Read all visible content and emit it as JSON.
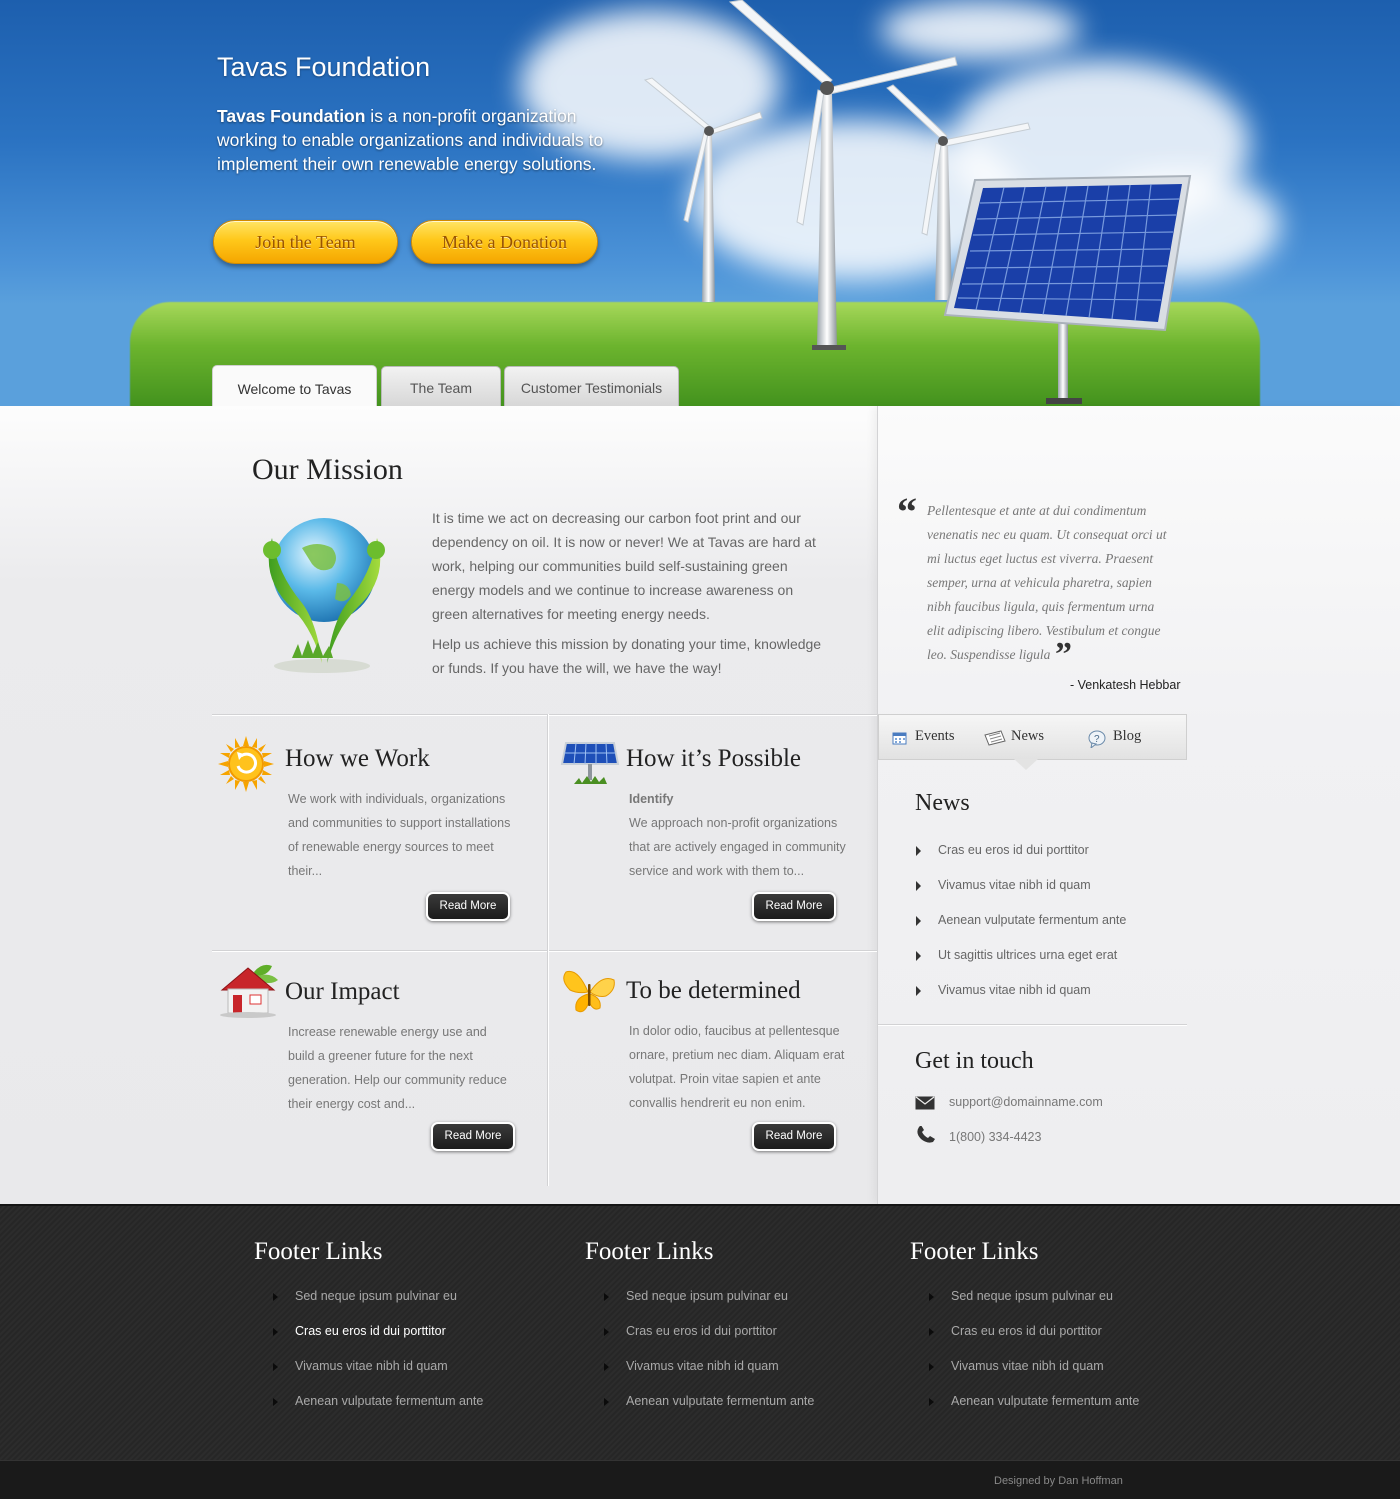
{
  "hero": {
    "title": "Tavas Foundation",
    "desc_bold": "Tavas Foundation",
    "desc_rest": " is a non-profit organization working to enable organizations and individuals to implement their own renewable energy solutions.",
    "buttons": {
      "join": "Join the Team",
      "donate": "Make a Donation"
    },
    "tabs": [
      "Welcome to Tavas",
      "The Team",
      "Customer Testimonials"
    ]
  },
  "mission": {
    "title": "Our Mission",
    "p1": "It is time we act on decreasing our carbon foot print and our dependency on oil. It is now or never! We at Tavas are hard at work, helping our communities build self-sustaining green energy models and we continue to increase awareness on green alternatives for meeting energy needs.",
    "p2": "Help us achieve this mission by donating your time, knowledge or funds. If you have the will, we have the way!"
  },
  "features": [
    {
      "title": "How we Work",
      "subtitle": "",
      "text": "We work with individuals, organizations and communities to support installations of renewable energy sources to meet their...",
      "button": "Read More",
      "icon": "sun-icon"
    },
    {
      "title": "How it’s Possible",
      "subtitle": "Identify",
      "text": "We approach non-profit organizations that are actively engaged in community service and work with them to...",
      "button": "Read More",
      "icon": "solar-panel-icon"
    },
    {
      "title": "Our Impact",
      "subtitle": "",
      "text": "Increase renewable energy use and build a greener future for the next generation. Help our community reduce their energy cost and...",
      "button": "Read More",
      "icon": "house-icon"
    },
    {
      "title": "To be determined",
      "subtitle": "",
      "text": "In dolor odio, faucibus at pellentesque ornare, pretium nec diam. Aliquam erat volutpat. Proin vitae sapien et ante convallis hendrerit eu non enim.",
      "button": "Read More",
      "icon": "butterfly-icon"
    }
  ],
  "testimonial": {
    "text": "Pellentesque et ante at dui condimentum venenatis nec eu quam. Ut consequat orci ut mi luctus eget luctus est viverra. Praesent semper, urna at vehicula pharetra, sapien nibh faucibus ligula, quis fermentum urna elit adipiscing libero. Vestibulum et congue leo. Suspendisse ligula",
    "author": "- Venkatesh Hebbar"
  },
  "sidebar": {
    "tabs": [
      "Events",
      "News",
      "Blog"
    ],
    "news_title": "News",
    "news": [
      "Cras eu eros id dui porttitor",
      "Vivamus vitae nibh id quam",
      "Aenean vulputate fermentum ante",
      "Ut sagittis ultrices urna eget erat",
      "Vivamus vitae nibh id quam"
    ],
    "contact_title": "Get in touch",
    "email": "support@domainname.com",
    "phone": "1(800) 334-4423"
  },
  "footer": {
    "columns": [
      {
        "title": "Footer Links",
        "links": [
          "Sed neque ipsum pulvinar eu",
          "Cras eu eros id dui porttitor",
          "Vivamus vitae nibh id quam",
          "Aenean vulputate fermentum ante"
        ]
      },
      {
        "title": "Footer Links",
        "links": [
          "Sed neque ipsum pulvinar eu",
          "Cras eu eros id dui porttitor",
          "Vivamus vitae nibh id quam",
          "Aenean vulputate fermentum ante"
        ]
      },
      {
        "title": "Footer Links",
        "links": [
          "Sed neque ipsum pulvinar eu",
          "Cras eu eros id dui porttitor",
          "Vivamus vitae nibh id quam",
          "Aenean vulputate fermentum ante"
        ]
      }
    ],
    "credit": "Designed by Dan Hoffman"
  }
}
